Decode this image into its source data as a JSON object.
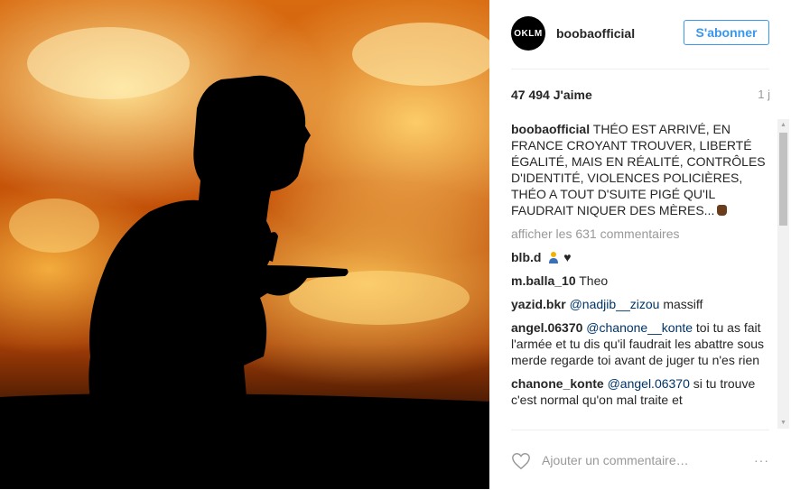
{
  "post": {
    "username": "boobaofficial",
    "avatar_text": "OKLM",
    "follow_label": "S'abonner",
    "likes": "47 494 J'aime",
    "time": "1 j",
    "caption": "THÉO EST ARRIVÉ, EN FRANCE CROYANT TROUVER, LIBERTÉ ÉGALITÉ, MAIS EN RÉALITÉ, CONTRÔLES D'IDENTITÉ, VIOLENCES POLICIÈRES, THÉO A TOUT D'SUITE PIGÉ QU'IL FAUDRAIT NIQUER DES MÈRES...",
    "caption_emoji": "raised-fist-icon",
    "more_comments": "afficher les 631 commentaires"
  },
  "comments": [
    {
      "user": "blb.d",
      "mention": "",
      "text": "",
      "emoji": "person-icon",
      "suffix": "♥"
    },
    {
      "user": "m.balla_10",
      "mention": "",
      "text": "Theo"
    },
    {
      "user": "yazid.bkr",
      "mention": "@nadjib__zizou",
      "text": "massiff"
    },
    {
      "user": "angel.06370",
      "mention": "@chanone__konte",
      "text": "toi tu as fait l'armée et tu dis qu'il faudrait les abattre sous merde regarde toi avant de juger tu n'es rien"
    },
    {
      "user": "chanone_konte",
      "mention": "@angel.06370",
      "text": "si tu trouve c'est normal qu'on mal traite et"
    }
  ],
  "footer": {
    "comment_placeholder": "Ajouter un commentaire…",
    "options": "···"
  },
  "colors": {
    "accent": "#3897f0",
    "mention": "#003569",
    "muted": "#999999"
  }
}
